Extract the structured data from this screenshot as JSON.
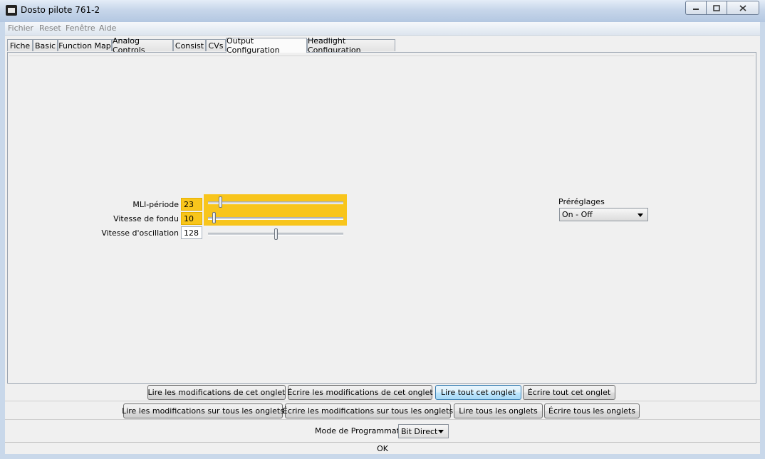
{
  "window": {
    "title": "Dosto pilote 761-2",
    "app_icon": "locomotive-icon",
    "controls": {
      "minimize": "minimize-icon",
      "maximize": "maximize-icon",
      "close": "close-icon"
    }
  },
  "menu": {
    "file": "Fichier",
    "reset": "Reset",
    "window": "Fenêtre",
    "help": "Aide"
  },
  "tabs": [
    "Fiche",
    "Basic",
    "Function Map",
    "Analog Controls",
    "Consist",
    "CVs",
    "Output Configuration",
    "Headlight Configuration"
  ],
  "selected_tab": "Output Configuration",
  "params": {
    "pwm": {
      "label": "MLI-période",
      "value": "23",
      "highlighted": true,
      "slider_fraction": 0.09
    },
    "fade": {
      "label": "Vitesse de fondu",
      "value": "10",
      "highlighted": true,
      "slider_fraction": 0.04
    },
    "oscillation": {
      "label": "Vitesse d'oscillation",
      "value": "128",
      "highlighted": false,
      "slider_fraction": 0.5
    }
  },
  "highlight_color": "#f8c51c",
  "presets": {
    "label": "Préréglages",
    "selected": "On - Off"
  },
  "buttons_tab": {
    "read_changes": "Lire les modifications de cet onglet",
    "write_changes": "Écrire les modifications de cet onglet",
    "read_all": "Lire tout cet onglet",
    "write_all": "Écrire tout cet onglet"
  },
  "buttons_all": {
    "read_changes": "Lire les modifications sur tous les onglets",
    "write_changes": "Écrire les modifications sur tous les onglets",
    "read_all": "Lire tous les onglets",
    "write_all": "Écrire tous les onglets"
  },
  "programming": {
    "label": "Mode de Programmation",
    "selected": "Bit Direct"
  },
  "status": "OK"
}
